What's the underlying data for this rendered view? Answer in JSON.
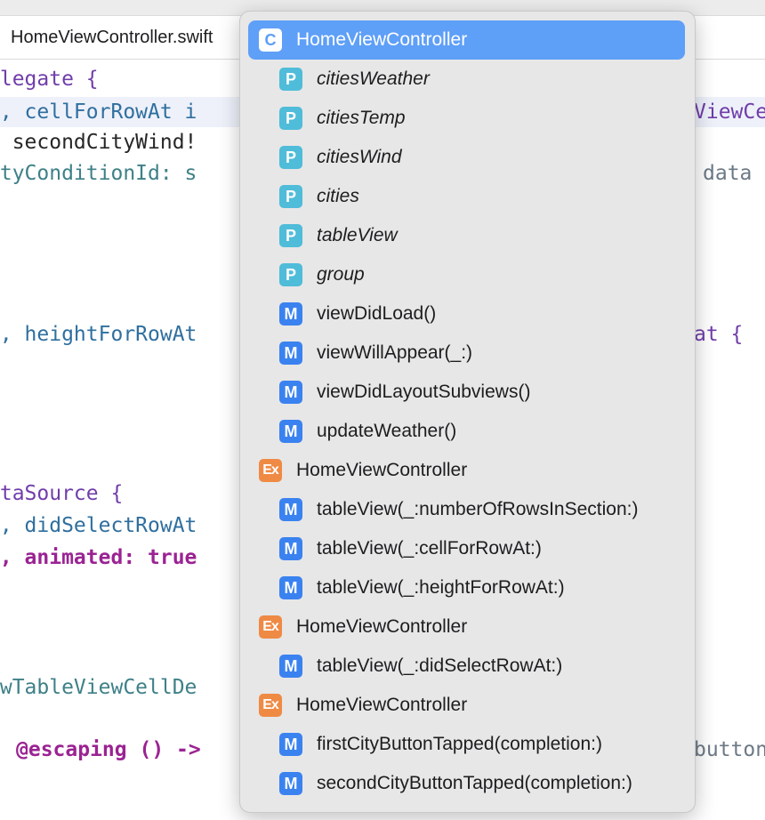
{
  "editor": {
    "tab_title": "HomeViewController.swift",
    "code_lines": [
      [
        "elegate {"
      ],
      [
        "w, cellForRowAt i",
        "ViewCe"
      ],
      [
        ": secondCityWind!"
      ],
      [
        "ityConditionId: s",
        "data"
      ],
      [
        "w, heightForRowAt",
        "at {"
      ],
      [
        "ataSource {"
      ],
      [
        "w, didSelectRowAt"
      ],
      [
        "h, animated: true"
      ],
      [
        "ewTableViewCellDe"
      ],
      [
        "@escaping () ->",
        "button"
      ]
    ]
  },
  "popup": {
    "items": [
      {
        "kind": "C",
        "label": "HomeViewController",
        "selected": true
      },
      {
        "kind": "P",
        "label": "citiesWeather"
      },
      {
        "kind": "P",
        "label": "citiesTemp"
      },
      {
        "kind": "P",
        "label": "citiesWind"
      },
      {
        "kind": "P",
        "label": "cities"
      },
      {
        "kind": "P",
        "label": "tableView"
      },
      {
        "kind": "P",
        "label": "group"
      },
      {
        "kind": "M",
        "label": "viewDidLoad()"
      },
      {
        "kind": "M",
        "label": "viewWillAppear(_:)"
      },
      {
        "kind": "M",
        "label": "viewDidLayoutSubviews()"
      },
      {
        "kind": "M",
        "label": "updateWeather()"
      },
      {
        "kind": "Ex",
        "label": "HomeViewController"
      },
      {
        "kind": "M",
        "label": "tableView(_:numberOfRowsInSection:)"
      },
      {
        "kind": "M",
        "label": "tableView(_:cellForRowAt:)"
      },
      {
        "kind": "M",
        "label": "tableView(_:heightForRowAt:)"
      },
      {
        "kind": "Ex",
        "label": "HomeViewController"
      },
      {
        "kind": "M",
        "label": "tableView(_:didSelectRowAt:)"
      },
      {
        "kind": "Ex",
        "label": "HomeViewController"
      },
      {
        "kind": "M",
        "label": "firstCityButtonTapped(completion:)"
      },
      {
        "kind": "M",
        "label": "secondCityButtonTapped(completion:)"
      }
    ]
  },
  "colors": {
    "selection": "#5e9ff8",
    "property_badge": "#4fbcd9",
    "method_badge": "#3a82f0",
    "extension_badge": "#ef8a45",
    "popup_background": "#e7e7e7"
  }
}
